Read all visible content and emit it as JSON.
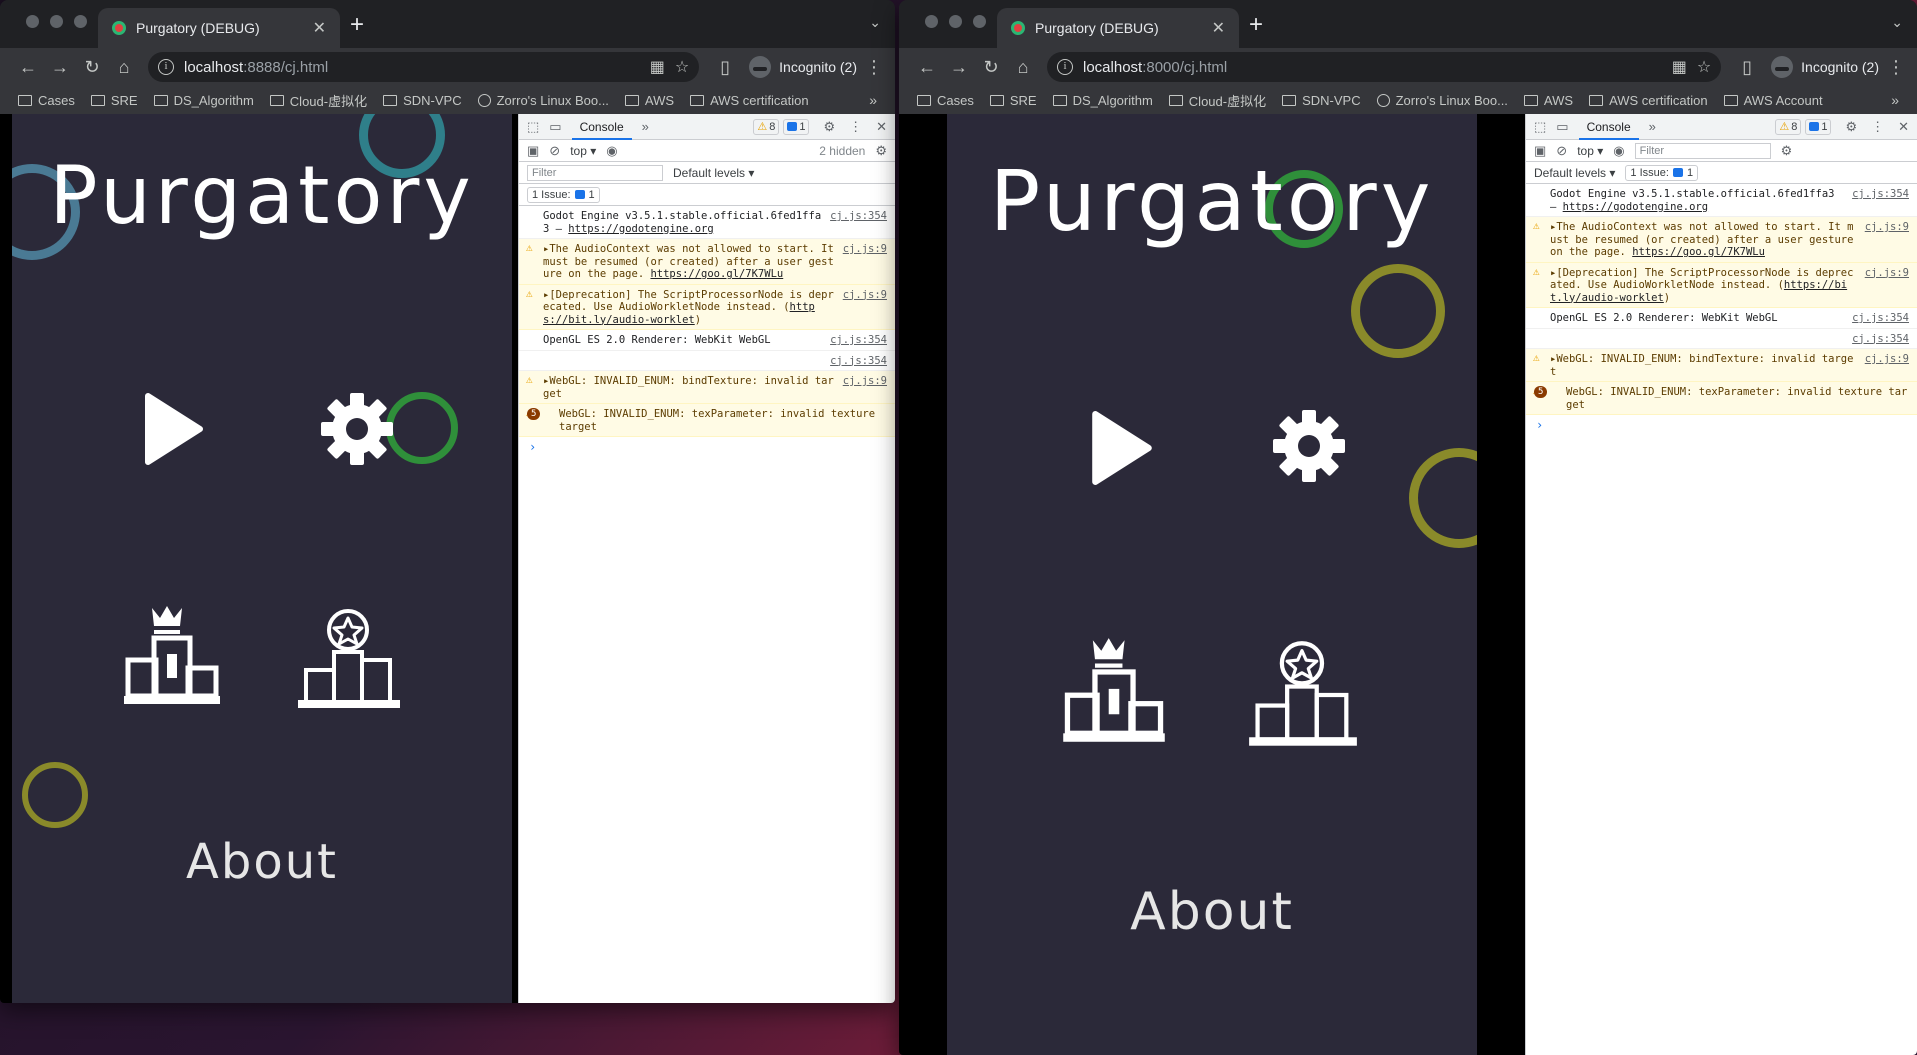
{
  "windows": [
    {
      "tab_title": "Purgatory (DEBUG)",
      "url_host": "localhost",
      "url_rest": ":8888/cj.html",
      "incognito": "Incognito (2)",
      "bookmarks": [
        "Cases",
        "SRE",
        "DS_Algorithm",
        "Cloud-虚拟化",
        "SDN-VPC",
        "Zorro's Linux Boo...",
        "AWS",
        "AWS certification"
      ],
      "game": {
        "title": "Purgatory",
        "about": "About"
      },
      "devtools": {
        "tab": "Console",
        "warn_count": "8",
        "msg_count": "1",
        "context": "top",
        "filter_placeholder": "Filter",
        "levels": "Default levels",
        "hidden": "2 hidden",
        "issues_label": "1 Issue:",
        "issues_count": "1",
        "logs": [
          {
            "type": "info",
            "text": "Godot Engine v3.5.1.stable.official.6fed1ffa3 – ",
            "link": "https://godotengine.org",
            "src": "cj.js:354"
          },
          {
            "type": "warn",
            "text": "▸The AudioContext was not allowed to start. It must be resumed (or created) after a user gesture on the page. ",
            "link": "https://goo.gl/7K7WLu",
            "src": "cj.js:9"
          },
          {
            "type": "warn",
            "text": "▸[Deprecation] The ScriptProcessorNode is deprecated. Use AudioWorkletNode instead. (",
            "link": "https://bit.ly/audio-worklet",
            "src": "cj.js:9"
          },
          {
            "type": "info",
            "text": "OpenGL ES 2.0 Renderer: WebKit WebGL",
            "link": "",
            "src": "cj.js:354"
          },
          {
            "type": "info",
            "text": "",
            "link": "",
            "src": "cj.js:354"
          },
          {
            "type": "warn",
            "text": "▸WebGL: INVALID_ENUM: bindTexture: invalid target",
            "link": "",
            "src": "cj.js:9"
          },
          {
            "type": "warn",
            "count": "5",
            "text": "WebGL: INVALID_ENUM: texParameter: invalid texture target",
            "link": "",
            "src": ""
          }
        ]
      }
    },
    {
      "tab_title": "Purgatory (DEBUG)",
      "url_host": "localhost",
      "url_rest": ":8000/cj.html",
      "incognito": "Incognito (2)",
      "bookmarks": [
        "Cases",
        "SRE",
        "DS_Algorithm",
        "Cloud-虚拟化",
        "SDN-VPC",
        "Zorro's Linux Boo...",
        "AWS",
        "AWS certification",
        "AWS Account"
      ],
      "game": {
        "title": "Purgatory",
        "about": "About"
      },
      "devtools": {
        "tab": "Console",
        "warn_count": "8",
        "msg_count": "1",
        "context": "top",
        "filter_placeholder": "Filter",
        "levels": "Default levels",
        "hidden": "",
        "issues_label": "1 Issue:",
        "issues_count": "1",
        "logs": [
          {
            "type": "info",
            "text": "Godot Engine v3.5.1.stable.official.6fed1ffa3 – ",
            "link": "https://godotengine.org",
            "src": "cj.js:354"
          },
          {
            "type": "warn",
            "text": "▸The AudioContext was not allowed to start. It must be resumed (or created) after a user gesture on the page. ",
            "link": "https://goo.gl/7K7WLu",
            "src": "cj.js:9"
          },
          {
            "type": "warn",
            "text": "▸[Deprecation] The ScriptProcessorNode is deprecated. Use AudioWorkletNode instead. (",
            "link": "https://bit.ly/audio-worklet",
            "src": "cj.js:9"
          },
          {
            "type": "info",
            "text": "OpenGL ES 2.0 Renderer: WebKit WebGL",
            "link": "",
            "src": "cj.js:354"
          },
          {
            "type": "info",
            "text": "",
            "link": "",
            "src": "cj.js:354"
          },
          {
            "type": "warn",
            "text": "▸WebGL: INVALID_ENUM: bindTexture: invalid target",
            "link": "",
            "src": "cj.js:9"
          },
          {
            "type": "warn",
            "count": "5",
            "text": "WebGL: INVALID_ENUM: texParameter: invalid texture target",
            "link": "",
            "src": ""
          }
        ]
      }
    }
  ],
  "colors": {
    "game_bg": "#2b2939",
    "ring_teal": "#2f7f8a",
    "ring_green": "#2f8f3a",
    "ring_olive": "#8a8a2a",
    "ring_blue": "#4a7a94"
  }
}
